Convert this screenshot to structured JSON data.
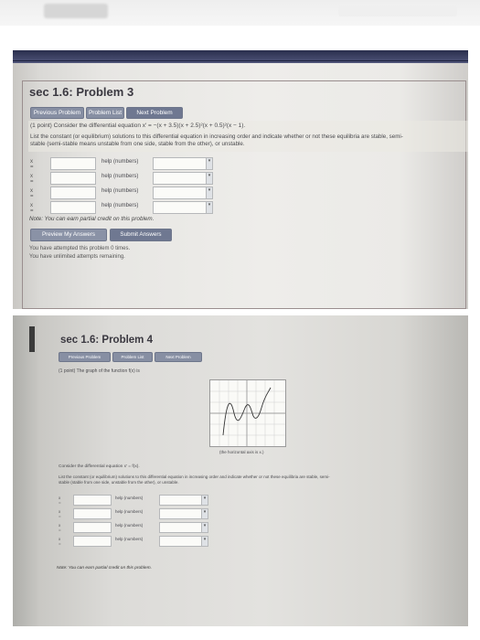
{
  "problem1": {
    "title": "sec 1.6: Problem 3",
    "nav": {
      "prev": "Previous Problem",
      "list": "Problem List",
      "next": "Next Problem"
    },
    "question": "(1 point) Consider the differential equation x′ = −(x + 3.5)(x + 2.5)²(x + 0.5)²(x − 1).",
    "instructions_line1": "List the constant (or equilibrium) solutions to this differential equation in increasing order and indicate whether or not these equilibria are stable, semi-",
    "instructions_line2": "stable (semi-stable means unstable from one side, stable from the other), or unstable.",
    "rows": [
      {
        "label": "x =",
        "help": "help (numbers)"
      },
      {
        "label": "x =",
        "help": "help (numbers)"
      },
      {
        "label": "x =",
        "help": "help (numbers)"
      },
      {
        "label": "x =",
        "help": "help (numbers)"
      }
    ],
    "note": "Note: You can earn partial credit on this problem.",
    "preview_label": "Preview My Answers",
    "submit_label": "Submit Answers",
    "attempts_line1": "You have attempted this problem 0 times.",
    "attempts_line2": "You have unlimited attempts remaining."
  },
  "problem2": {
    "title": "sec 1.6: Problem 4",
    "nav": {
      "prev": "Previous Problem",
      "list": "Problem List",
      "next": "Next Problem"
    },
    "question": "(1 point) The graph of the function f(x) is",
    "axis_note": "(the horizontal axis is x.)",
    "consider": "Consider the differential equation x′ = f(x).",
    "instructions_line1": "List the constant (or equilibrium) solutions to this differential equation in increasing order and indicate whether or not these equilibria are stable, semi-",
    "instructions_line2": "stable (stable from one side, unstable from the other), or unstable.",
    "rows": [
      {
        "label": "x =",
        "help": "help (numbers)"
      },
      {
        "label": "x =",
        "help": "help (numbers)"
      },
      {
        "label": "x =",
        "help": "help (numbers)"
      },
      {
        "label": "x =",
        "help": "help (numbers)"
      }
    ],
    "note": "Note: You can earn partial credit on this problem."
  },
  "colors": {
    "button": "#878fa3",
    "navy_bar": "#2a2f4d",
    "page": "#ffffff"
  }
}
